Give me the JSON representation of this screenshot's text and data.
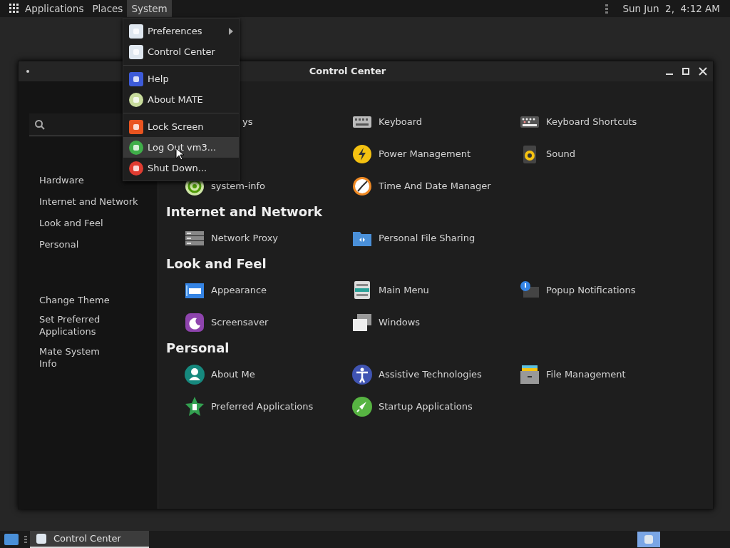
{
  "top_panel": {
    "menus": [
      {
        "label": "Applications",
        "selected": false
      },
      {
        "label": "Places",
        "selected": false
      },
      {
        "label": "System",
        "selected": true
      }
    ],
    "clock": "Sun Jun  2,  4:12 AM"
  },
  "window": {
    "title": "Control Center",
    "sidebar": {
      "groups": [
        "Hardware",
        "Internet and Network",
        "Look and Feel",
        "Personal"
      ],
      "actions": [
        "Change Theme",
        "Set Preferred Applications",
        "Mate System Info"
      ]
    },
    "sections": [
      {
        "rows": [
          [
            {
              "kind": "partial",
              "label": "ys"
            },
            {
              "kind": "item",
              "label": "Keyboard"
            },
            {
              "kind": "item",
              "label": "Keyboard Shortcuts"
            }
          ],
          [
            {
              "kind": "hidden"
            },
            {
              "kind": "item",
              "label": "Power Management"
            },
            {
              "kind": "item",
              "label": "Sound"
            }
          ],
          [
            {
              "kind": "item",
              "label": "system-info"
            },
            {
              "kind": "item",
              "label": "Time And Date Manager"
            }
          ]
        ]
      },
      {
        "heading": "Internet and Network",
        "rows": [
          [
            {
              "kind": "item",
              "label": "Network Proxy"
            },
            {
              "kind": "item",
              "label": "Personal File Sharing"
            }
          ]
        ]
      },
      {
        "heading": "Look and Feel",
        "rows": [
          [
            {
              "kind": "item",
              "label": "Appearance"
            },
            {
              "kind": "item",
              "label": "Main Menu"
            },
            {
              "kind": "item",
              "label": "Popup Notifications"
            }
          ],
          [
            {
              "kind": "item",
              "label": "Screensaver"
            },
            {
              "kind": "item",
              "label": "Windows"
            }
          ]
        ]
      },
      {
        "heading": "Personal",
        "rows": [
          [
            {
              "kind": "item",
              "label": "About Me"
            },
            {
              "kind": "item",
              "label": "Assistive Technologies"
            },
            {
              "kind": "item",
              "label": "File Management"
            }
          ],
          [
            {
              "kind": "item",
              "label": "Preferred Applications"
            },
            {
              "kind": "item",
              "label": "Startup Applications"
            }
          ]
        ]
      }
    ]
  },
  "system_menu": {
    "groups": [
      [
        {
          "label": "Preferences",
          "submenu": true,
          "selected": false
        },
        {
          "label": "Control Center",
          "submenu": false,
          "selected": false
        }
      ],
      [
        {
          "label": "Help",
          "submenu": false,
          "selected": false
        },
        {
          "label": "About MATE",
          "submenu": false,
          "selected": false
        }
      ],
      [
        {
          "label": "Lock Screen",
          "submenu": false,
          "selected": false
        },
        {
          "label": "Log Out vm3...",
          "submenu": false,
          "selected": true
        },
        {
          "label": "Shut Down...",
          "submenu": false,
          "selected": false
        }
      ]
    ]
  },
  "taskbar": {
    "tasks": [
      {
        "label": "Control Center",
        "selected": true
      }
    ]
  }
}
